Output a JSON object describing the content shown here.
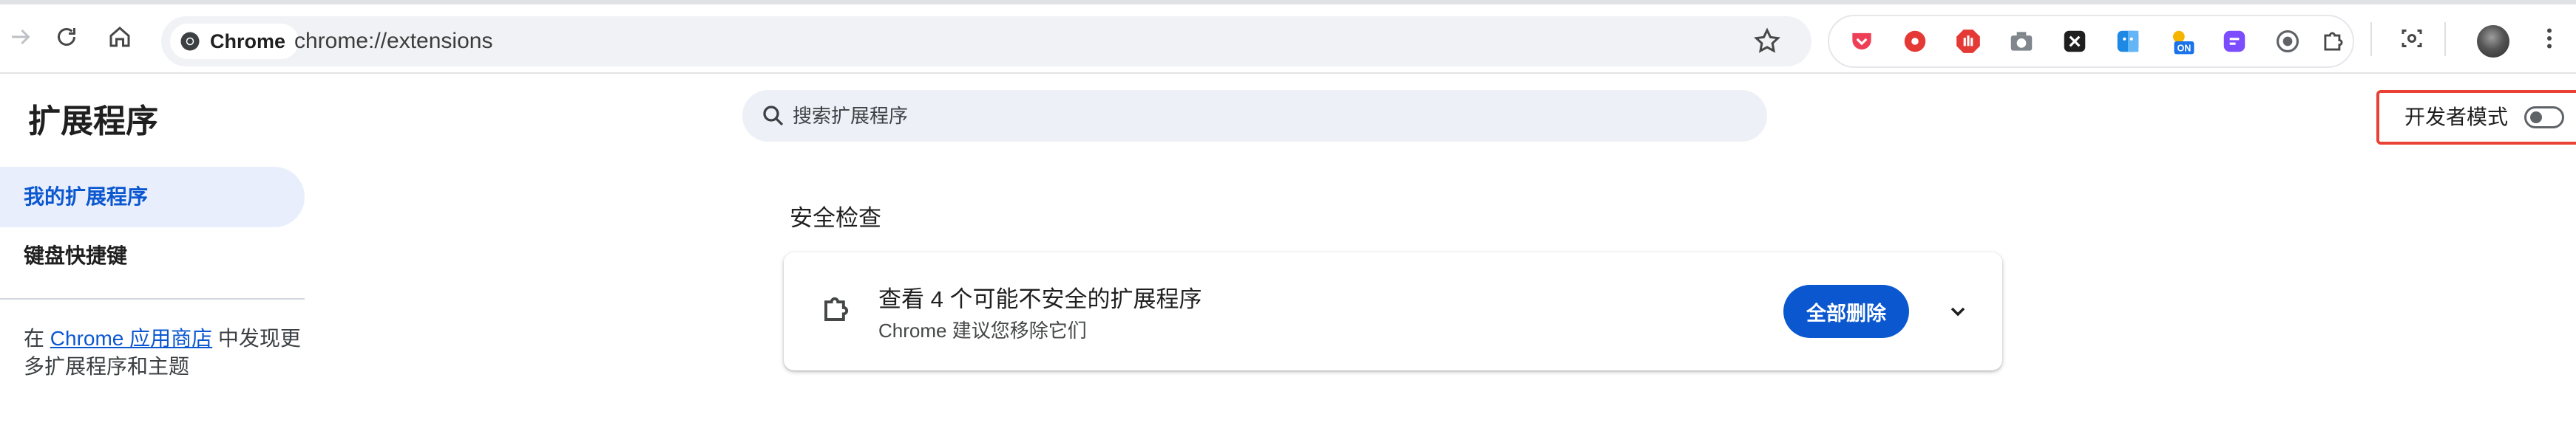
{
  "browser": {
    "chip_label": "Chrome",
    "url": "chrome://extensions"
  },
  "page": {
    "title": "扩展程序",
    "search_placeholder": "搜索扩展程序",
    "dev_mode_label": "开发者模式",
    "dev_mode_on": false
  },
  "sidebar": {
    "items": [
      {
        "label": "我的扩展程序",
        "active": true
      },
      {
        "label": "键盘快捷键",
        "active": false
      }
    ],
    "discover_prefix": "在 ",
    "discover_link": "Chrome 应用商店",
    "discover_suffix": " 中发现更多扩展程序和主题"
  },
  "safety": {
    "section_title": "安全检查",
    "card_title": "查看 4 个可能不安全的扩展程序",
    "card_subtitle": "Chrome 建议您移除它们",
    "remove_all_label": "全部删除"
  },
  "extension_icons": [
    {
      "name": "pocket-icon",
      "color": "#ef3f56"
    },
    {
      "name": "record-icon",
      "color": "#e53935"
    },
    {
      "name": "stop-hand-icon",
      "color": "#e53935"
    },
    {
      "name": "camera-icon",
      "color": "#80868b"
    },
    {
      "name": "x-icon",
      "color": "#1f1f1f"
    },
    {
      "name": "finder-icon",
      "color": "#1e88e5"
    },
    {
      "name": "on-badge-icon",
      "color": "#1a73e8",
      "badge": "ON"
    },
    {
      "name": "purple-chat-icon",
      "color": "#7c4dff"
    },
    {
      "name": "circle-record-icon",
      "color": "#5f6368"
    },
    {
      "name": "puzzle-icon",
      "color": "#5f6368"
    }
  ],
  "colors": {
    "accent": "#0b57d0",
    "highlight_border": "#e94235",
    "nav_active_bg": "#e8eefc"
  }
}
